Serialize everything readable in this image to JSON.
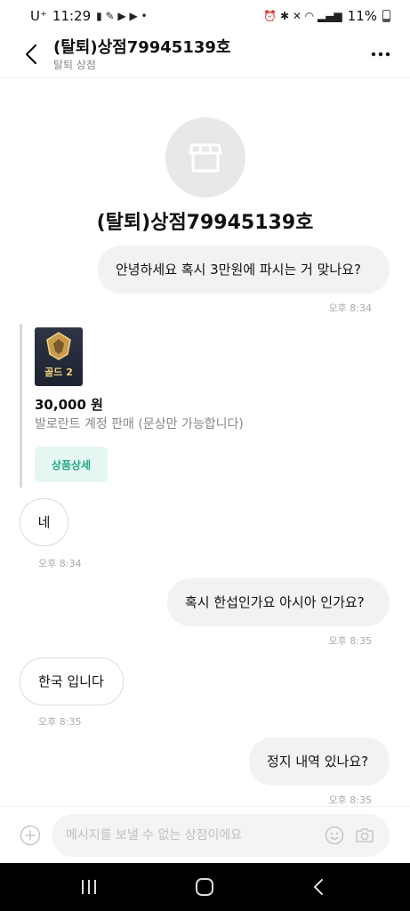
{
  "status_bar": {
    "carrier": "U⁺",
    "time": "11:29",
    "battery": "11%"
  },
  "header": {
    "title": "(탈퇴)상점79945139호",
    "subtitle": "탈퇴 상점"
  },
  "store": {
    "name": "(탈퇴)상점79945139호"
  },
  "messages": [
    {
      "text": "안녕하세요 혹시 3만원에 파시는 거 맞나요?",
      "time": "오후 8:34"
    },
    {
      "text": "네",
      "time": "오후 8:34"
    },
    {
      "text": "혹시 한섭인가요 아시아 인가요?",
      "time": "오후 8:35"
    },
    {
      "text": "한국 입니다",
      "time": "오후 8:35"
    },
    {
      "text": "정지 내역 있나요?",
      "time": "오후 8:35"
    }
  ],
  "product": {
    "badge": "골드 2",
    "price": "30,000 원",
    "description": "발로란트 계정 판매 (문상만 가능합니다)",
    "detail_button": "상품상세"
  },
  "input": {
    "placeholder": "메시지를 보낼 수 없는 상점이에요"
  },
  "colors": {
    "accent": "#23a98a",
    "accent_bg": "#e6f6f2",
    "outgoing_bubble": "#f2f2f2"
  },
  "icons": [
    "back-icon",
    "more-icon",
    "store-icon",
    "add-icon",
    "emoji-icon",
    "camera-icon",
    "recents-icon",
    "home-icon",
    "back-nav-icon"
  ]
}
